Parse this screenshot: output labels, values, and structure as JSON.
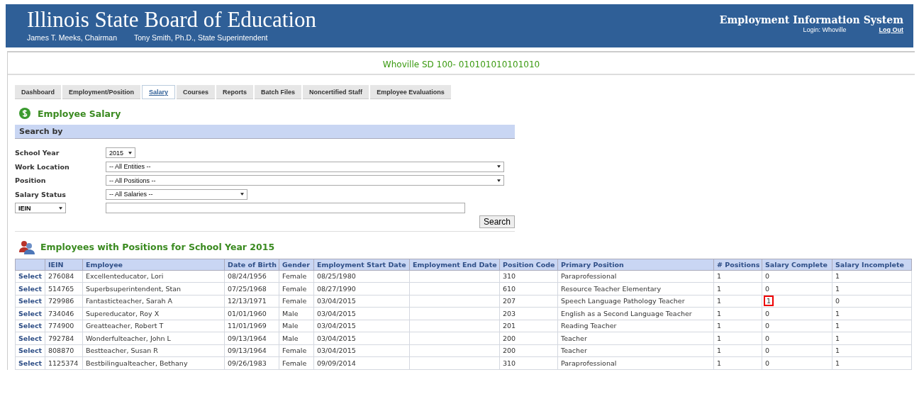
{
  "header": {
    "title": "Illinois State Board of Education",
    "officials": [
      "James T. Meeks, Chairman",
      "Tony Smith, Ph.D., State Superintendent"
    ],
    "system": "Employment Information System",
    "login": "Login: Whoville",
    "logout": "Log Out"
  },
  "district": "Whoville SD 100- 010101010101010",
  "tabs": [
    {
      "label": "Dashboard",
      "selected": false
    },
    {
      "label": "Employment/Position",
      "selected": false
    },
    {
      "label": "Salary",
      "selected": true
    },
    {
      "label": "Courses",
      "selected": false
    },
    {
      "label": "Reports",
      "selected": false
    },
    {
      "label": "Batch Files",
      "selected": false
    },
    {
      "label": "Noncertified Staff",
      "selected": false
    },
    {
      "label": "Employee Evaluations",
      "selected": false
    }
  ],
  "page_title": "Employee Salary",
  "search": {
    "heading": "Search by",
    "fields": [
      {
        "label": "School Year",
        "value": "2015",
        "kind": "small"
      },
      {
        "label": "Work Location",
        "value": "-- All Entities --",
        "kind": "wide"
      },
      {
        "label": "Position",
        "value": "-- All Positions --",
        "kind": "wide"
      },
      {
        "label": "Salary Status",
        "value": "-- All Salaries --",
        "kind": "medium"
      }
    ],
    "id_type": "IEIN",
    "button": "Search"
  },
  "table": {
    "title": "Employees with Positions for School Year 2015",
    "columns": [
      "",
      "IEIN",
      "Employee",
      "Date of Birth",
      "Gender",
      "Employment Start Date",
      "Employment End Date",
      "Position Code",
      "Primary Position",
      "# Positions",
      "Salary Complete",
      "Salary Incomplete"
    ],
    "rows": [
      {
        "action": "Select",
        "iein": "276084",
        "employee": "Excellenteducator, Lori",
        "dob": "08/24/1956",
        "gender": "Female",
        "start": "08/25/1980",
        "position_code": "310",
        "primary_position": "Paraprofessional",
        "positions": "1",
        "salary_complete": "0",
        "salary_incomplete": "1",
        "highlighted": false
      },
      {
        "action": "Select",
        "iein": "514765",
        "employee": "Superbsuperintendent, Stan",
        "dob": "07/25/1968",
        "gender": "Female",
        "start": "08/27/1990",
        "position_code": "610",
        "primary_position": "Resource Teacher Elementary",
        "positions": "1",
        "salary_complete": "0",
        "salary_incomplete": "1",
        "highlighted": false
      },
      {
        "action": "Select",
        "iein": "729986",
        "employee": "Fantasticteacher, Sarah A",
        "dob": "12/13/1971",
        "gender": "Female",
        "start": "03/04/2015",
        "position_code": "207",
        "primary_position": "Speech Language Pathology Teacher",
        "positions": "1",
        "salary_complete": "1",
        "salary_incomplete": "0",
        "highlighted": true
      },
      {
        "action": "Select",
        "iein": "734046",
        "employee": "Supereducator, Roy X",
        "dob": "01/01/1960",
        "gender": "Male",
        "start": "03/04/2015",
        "position_code": "203",
        "primary_position": "English as a Second Language Teacher",
        "positions": "1",
        "salary_complete": "0",
        "salary_incomplete": "1",
        "highlighted": false
      },
      {
        "action": "Select",
        "iein": "774900",
        "employee": "Greatteacher, Robert T",
        "dob": "11/01/1969",
        "gender": "Male",
        "start": "03/04/2015",
        "position_code": "201",
        "primary_position": "Reading Teacher",
        "positions": "1",
        "salary_complete": "0",
        "salary_incomplete": "1",
        "highlighted": false
      },
      {
        "action": "Select",
        "iein": "792784",
        "employee": "Wonderfulteacher, John L",
        "dob": "09/13/1964",
        "gender": "Male",
        "start": "03/04/2015",
        "position_code": "200",
        "primary_position": "Teacher",
        "positions": "1",
        "salary_complete": "0",
        "salary_incomplete": "1",
        "highlighted": false
      },
      {
        "action": "Select",
        "iein": "808870",
        "employee": "Bestteacher, Susan R",
        "dob": "09/13/1964",
        "gender": "Female",
        "start": "03/04/2015",
        "position_code": "200",
        "primary_position": "Teacher",
        "positions": "1",
        "salary_complete": "0",
        "salary_incomplete": "1",
        "highlighted": false
      },
      {
        "action": "Select",
        "iein": "1125374",
        "employee": "Bestbilingualteacher, Bethany",
        "dob": "09/26/1983",
        "gender": "Female",
        "start": "09/09/2014",
        "position_code": "310",
        "primary_position": "Paraprofessional",
        "positions": "1",
        "salary_complete": "0",
        "salary_incomplete": "1",
        "highlighted": false
      }
    ]
  }
}
